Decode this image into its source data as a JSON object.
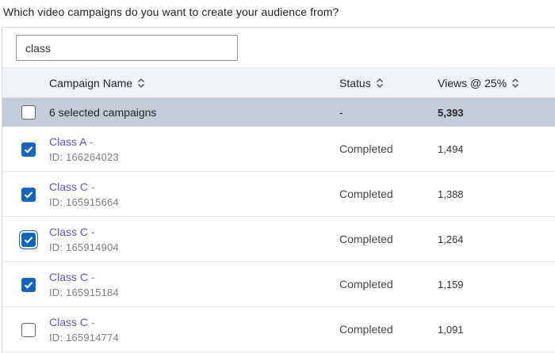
{
  "question": "Which video campaigns do you want to create your audience from?",
  "search": {
    "value": "class"
  },
  "columns": {
    "name": "Campaign Name",
    "status": "Status",
    "views": "Views @ 25%"
  },
  "summary": {
    "label": "6 selected campaigns",
    "status": "-",
    "views": "5,393"
  },
  "rows": [
    {
      "name": "Class A",
      "dash": "-",
      "id": "ID: 166264023",
      "status": "Completed",
      "views": "1,494",
      "checked": true
    },
    {
      "name": "Class C",
      "dash": "-",
      "id": "ID: 165915664",
      "status": "Completed",
      "views": "1,388",
      "checked": true
    },
    {
      "name": "Class C",
      "dash": "-",
      "id": "ID: 165914904",
      "status": "Completed",
      "views": "1,264",
      "checked": true
    },
    {
      "name": "Class C",
      "dash": "-",
      "id": "ID: 165915184",
      "status": "Completed",
      "views": "1,159",
      "checked": true
    },
    {
      "name": "Class C",
      "dash": "-",
      "id": "ID: 165914774",
      "status": "Completed",
      "views": "1,091",
      "checked": false
    }
  ],
  "colors": {
    "accent": "#1565b8",
    "link": "#6a52c9",
    "summary_bg": "#c5ced6",
    "header_bg": "#f1f4f7"
  }
}
